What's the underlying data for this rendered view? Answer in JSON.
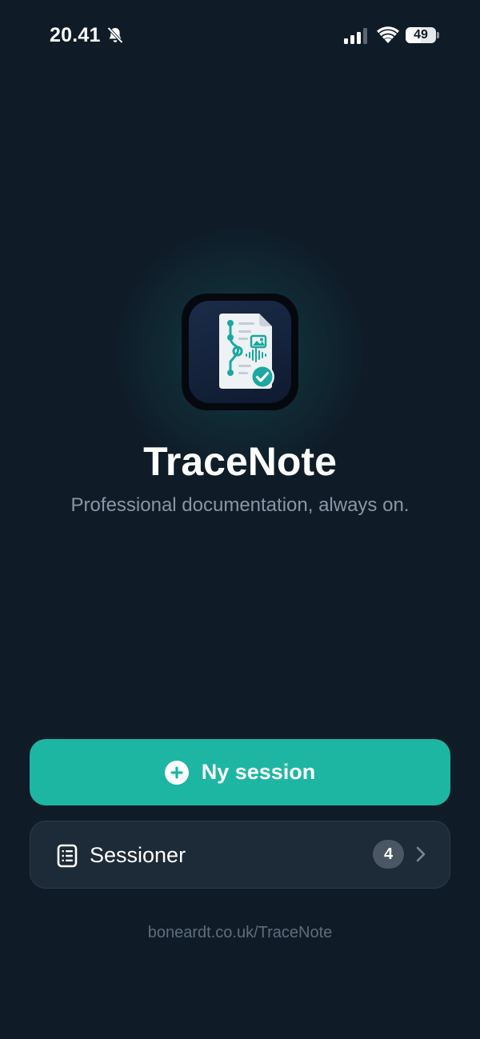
{
  "status_bar": {
    "time": "20.41",
    "battery_level": "49",
    "silent_mode": true
  },
  "app": {
    "title": "TraceNote",
    "tagline": "Professional documentation, always on.",
    "logo_icon": "document-timeline-checkmark-icon"
  },
  "actions": {
    "new_session_label": "Ny session",
    "sessions_label": "Sessioner",
    "sessions_count": "4"
  },
  "footer": {
    "link": "boneardt.co.uk/TraceNote"
  },
  "colors": {
    "background": "#0f1c28",
    "accent": "#1db6a3",
    "card": "#1d2a37",
    "muted_text": "#8a96a3"
  }
}
